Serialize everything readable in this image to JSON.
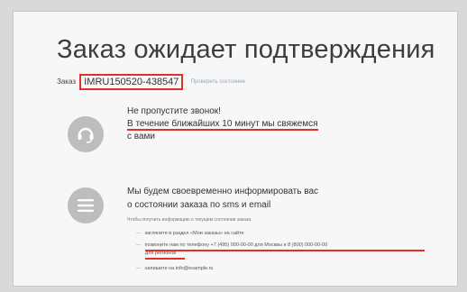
{
  "page": {
    "title": "Заказ ожидает подтверждения",
    "order_label": "Заказ",
    "order_number": "IMRU150520-438547",
    "order_link": "Проверить состояние"
  },
  "call_block": {
    "icon": "phone-headset-icon",
    "line1": "Не пропустите звонок!",
    "line2": "В течение ближайших 10 минут мы свяжемся",
    "line3": "с вами"
  },
  "info_block": {
    "icon": "menu-lines-icon",
    "line1": "Мы будем своевременно информировать вас",
    "line2": "о состоянии заказа по sms и email",
    "note": "Чтобы получить информацию о текущем состоянии заказа:",
    "items": [
      "загляните в раздел «Мои заказы» на сайте",
      "позвоните нам по телефону +7 (495) 000-00-00 для Москвы и 8 (800) 000-00-00",
      "для регионов",
      "напишите на info@example.ru"
    ]
  },
  "colors": {
    "accent": "#e0302a",
    "icon_bg": "#bdbdbd"
  }
}
